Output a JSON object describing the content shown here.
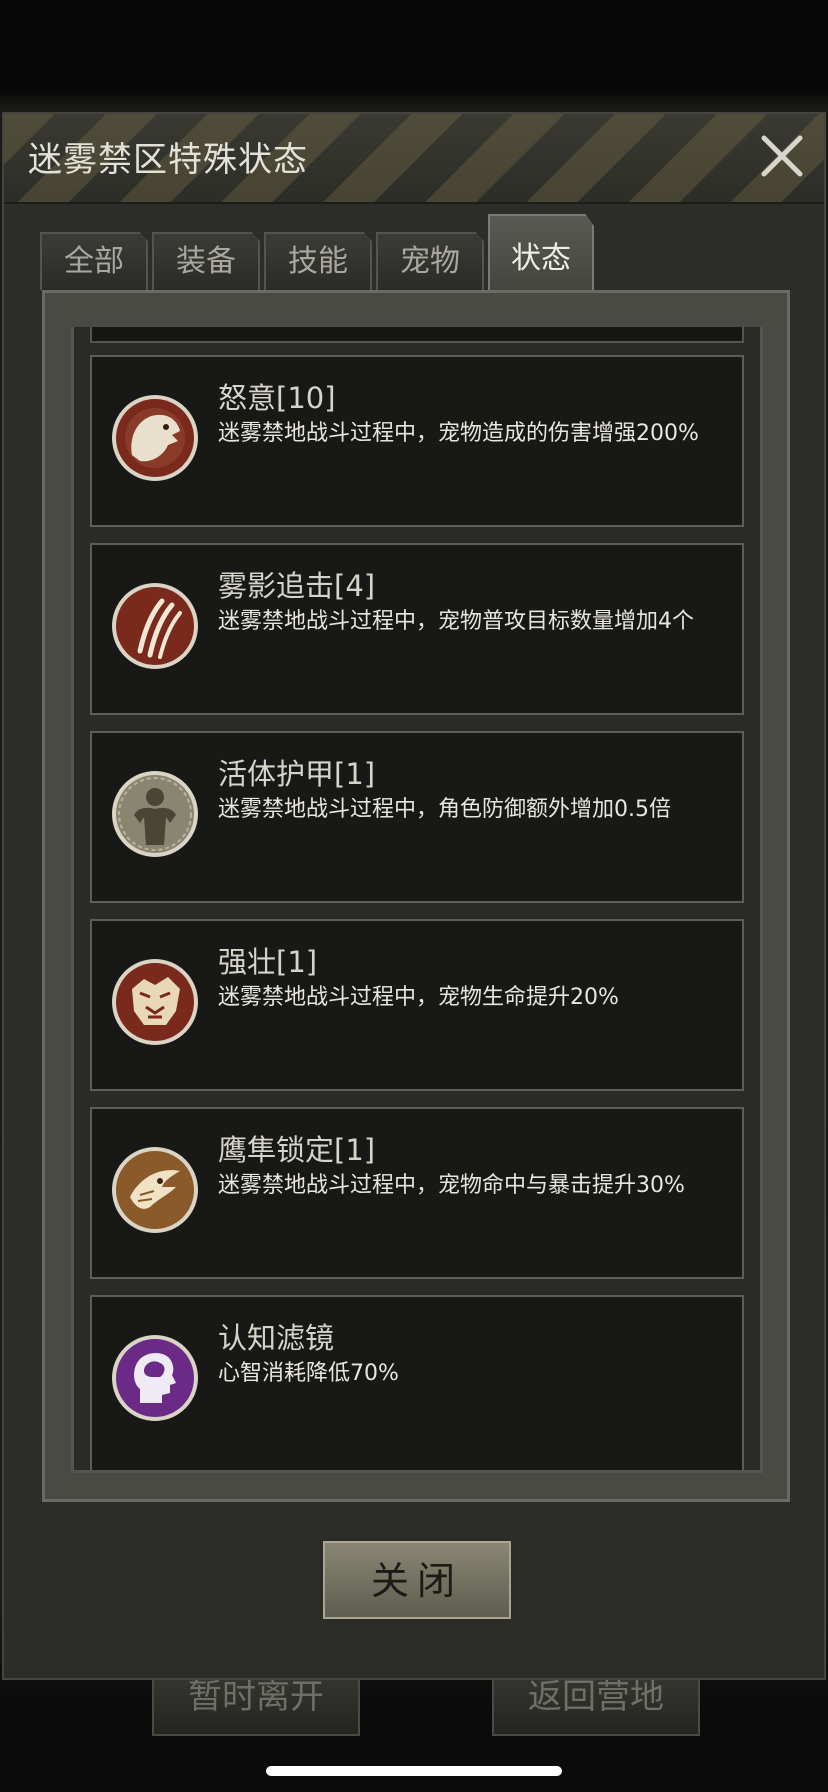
{
  "background": {
    "left_button": "暂时离开",
    "right_button": "返回营地"
  },
  "dialog": {
    "title": "迷雾禁区特殊状态",
    "close_button_label": "关闭",
    "tabs": [
      {
        "label": "全部",
        "active": false
      },
      {
        "label": "装备",
        "active": false
      },
      {
        "label": "技能",
        "active": false
      },
      {
        "label": "宠物",
        "active": false
      },
      {
        "label": "状态",
        "active": true
      }
    ],
    "items": [
      {
        "title": "怒意[10]",
        "desc": "迷雾禁地战斗过程中，宠物造成的伤害增强200%",
        "icon": "roaring-beast-icon"
      },
      {
        "title": "雾影追击[4]",
        "desc": "迷雾禁地战斗过程中，宠物普攻目标数量增加4个",
        "icon": "claw-marks-icon"
      },
      {
        "title": "活体护甲[1]",
        "desc": "迷雾禁地战斗过程中，角色防御额外增加0.5倍",
        "icon": "armored-body-icon"
      },
      {
        "title": "强壮[1]",
        "desc": "迷雾禁地战斗过程中，宠物生命提升20%",
        "icon": "tiger-head-icon"
      },
      {
        "title": "鹰隼锁定[1]",
        "desc": "迷雾禁地战斗过程中，宠物命中与暴击提升30%",
        "icon": "eagle-icon"
      },
      {
        "title": "认知滤镜",
        "desc": "心智消耗降低70%",
        "icon": "brain-head-icon"
      }
    ]
  },
  "colors": {
    "icon_red": "#7a2a1c",
    "icon_purple": "#6a2a86",
    "button_gold": "#8a8774"
  }
}
